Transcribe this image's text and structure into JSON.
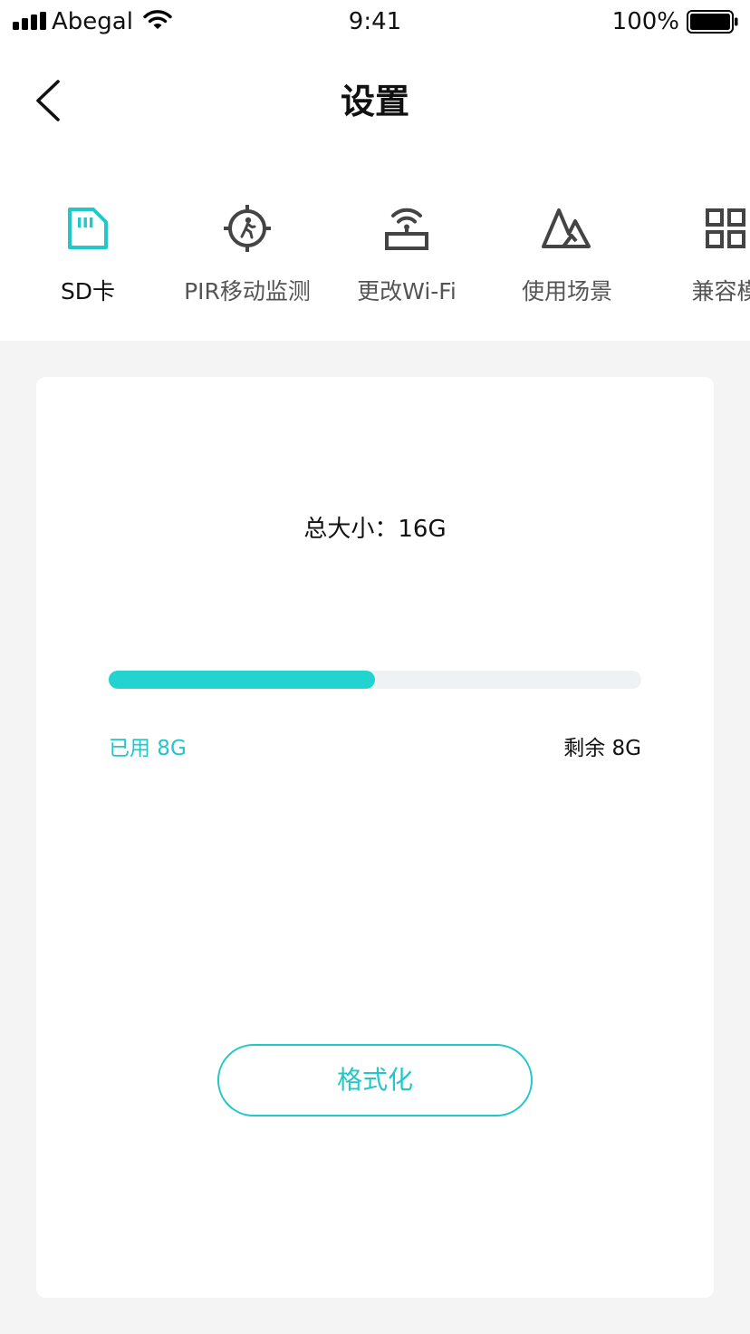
{
  "status_bar": {
    "carrier": "Abegal",
    "time": "9:41",
    "battery": "100%"
  },
  "nav": {
    "title": "设置",
    "back_icon": "chevron-left-icon"
  },
  "tabs": [
    {
      "label": "SD卡",
      "icon": "sd-card-icon",
      "active": true
    },
    {
      "label": "PIR移动监测",
      "icon": "motion-target-icon",
      "active": false
    },
    {
      "label": "更改Wi-Fi",
      "icon": "wifi-router-icon",
      "active": false
    },
    {
      "label": "使用场景",
      "icon": "mountain-icon",
      "active": false
    },
    {
      "label": "兼容模",
      "icon": "grid-icon",
      "active": false
    }
  ],
  "storage": {
    "total_text": "总大小：16G",
    "used_text": "已用 8G",
    "remaining_text": "剩余 8G",
    "used_fraction": 0.5
  },
  "actions": {
    "format_label": "格式化"
  },
  "colors": {
    "accent": "#22c7c9",
    "progress_fill": "#22d3d0",
    "progress_track": "#eef2f5",
    "icon_inactive": "#444444",
    "background": "#f4f4f4"
  }
}
